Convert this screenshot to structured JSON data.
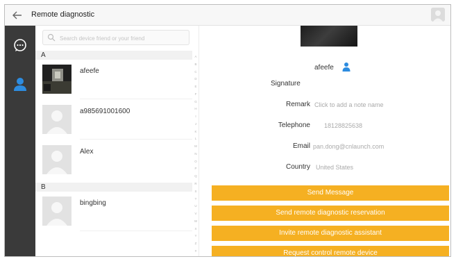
{
  "header": {
    "title": "Remote diagnostic"
  },
  "search": {
    "placeholder": "Search device friend or your friend"
  },
  "sections": [
    {
      "letter": "A"
    },
    {
      "letter": "B"
    }
  ],
  "contacts": [
    {
      "name": "afeefe",
      "photo": true
    },
    {
      "name": "a985691001600",
      "photo": false
    },
    {
      "name": "Alex",
      "photo": false
    },
    {
      "name": "bingbing",
      "photo": false
    }
  ],
  "index_letters": [
    "A",
    "B",
    "C",
    "D",
    "E",
    "F",
    "G",
    "H",
    "I",
    "J",
    "K",
    "L",
    "M",
    "N",
    "O",
    "P",
    "Q",
    "R",
    "S",
    "T",
    "U",
    "V",
    "W",
    "X",
    "Y",
    "Z",
    "#"
  ],
  "detail": {
    "name": "afeefe",
    "signature_label": "Signature",
    "remark_label": "Remark",
    "remark_value": "Click to add a note name",
    "telephone_label": "Telephone",
    "telephone_value": "18128825638",
    "email_label": "Email",
    "email_value": "pan.dong@cnlaunch.com",
    "country_label": "Country",
    "country_value": "United States"
  },
  "buttons": {
    "send_message": "Send Message",
    "send_reservation": "Send remote diagnostic reservation",
    "invite_assistant": "Invite remote diagnostic assistant",
    "request_control": "Request control remote device"
  },
  "colors": {
    "accent": "#f5b022",
    "rail": "#3a3a3a",
    "person_icon": "#2d8ce0"
  }
}
